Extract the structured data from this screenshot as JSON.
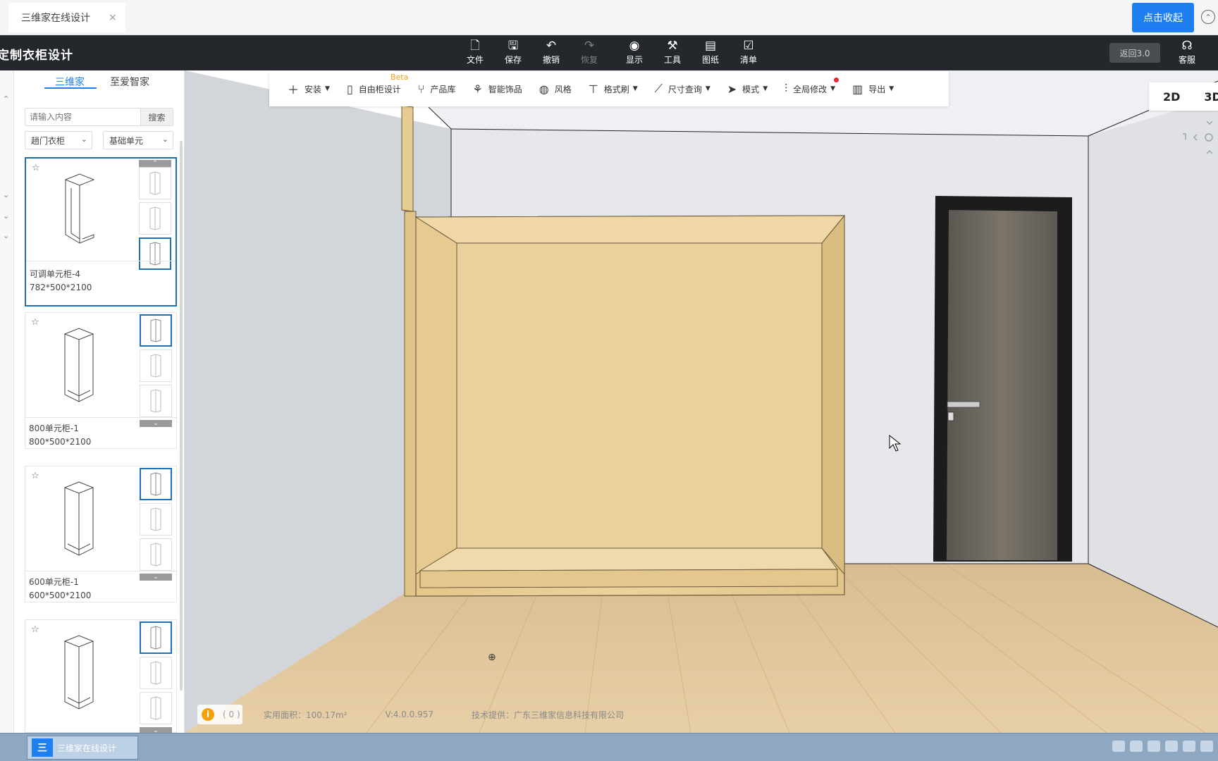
{
  "browser": {
    "tab_title": "三维家在线设计",
    "tab_close": "×",
    "collapse_button": "点击收起"
  },
  "header": {
    "app_title": "定制衣柜设计",
    "items": [
      {
        "label": "文件",
        "icon": "file-icon"
      },
      {
        "label": "保存",
        "icon": "save-icon"
      },
      {
        "label": "撤销",
        "icon": "undo-icon"
      },
      {
        "label": "恢复",
        "icon": "redo-icon",
        "disabled": true
      },
      {
        "label": "显示",
        "icon": "eye-icon"
      },
      {
        "label": "工具",
        "icon": "wrench-icon"
      },
      {
        "label": "图纸",
        "icon": "drawing-icon"
      },
      {
        "label": "清单",
        "icon": "checklist-icon"
      }
    ],
    "return_button": "返回3.0",
    "service": "客服"
  },
  "left_panel": {
    "tabs": [
      "三维家",
      "至爱智家"
    ],
    "active_tab": 0,
    "search": {
      "placeholder": "请输入内容",
      "button": "搜索"
    },
    "filters": [
      "趟门衣柜",
      "基础单元"
    ],
    "cards": [
      {
        "name": "可调单元柜-4",
        "dims": "782*500*2100",
        "selected": true
      },
      {
        "name": "800单元柜-1",
        "dims": "800*500*2100",
        "selected": false
      },
      {
        "name": "600单元柜-1",
        "dims": "600*500*2100",
        "selected": false
      }
    ]
  },
  "toolbar": {
    "items": [
      {
        "label": "安装",
        "icon": "plus-icon",
        "dropdown": true
      },
      {
        "label": "自由柜设计",
        "icon": "cabinet-icon",
        "dropdown": false,
        "badge": "Beta"
      },
      {
        "label": "产品库",
        "icon": "chair-icon",
        "dropdown": false
      },
      {
        "label": "智能饰品",
        "icon": "plant-icon",
        "dropdown": false
      },
      {
        "label": "风格",
        "icon": "palette-icon",
        "dropdown": false
      },
      {
        "label": "格式刷",
        "icon": "brush-icon",
        "dropdown": true
      },
      {
        "label": "尺寸查询",
        "icon": "ruler-icon",
        "dropdown": true
      },
      {
        "label": "模式",
        "icon": "cursor-icon",
        "dropdown": true
      },
      {
        "label": "全局修改",
        "icon": "sliders-icon",
        "dropdown": true
      },
      {
        "label": "导出",
        "icon": "map-icon",
        "dropdown": true
      }
    ]
  },
  "view": {
    "mode_2d": "2D",
    "mode_3d": "3D"
  },
  "status": {
    "info_count": "( 0 )",
    "area": "实用面积：100.17m²",
    "version": "V:4.0.0.957",
    "provider": "技术提供：广东三维家信息科技有限公司"
  },
  "taskbar": {
    "app_label": "三维家在线设计"
  },
  "colors": {
    "accent": "#1e7ff0",
    "header_bg": "#24272c",
    "wood": "#e8cd94"
  }
}
